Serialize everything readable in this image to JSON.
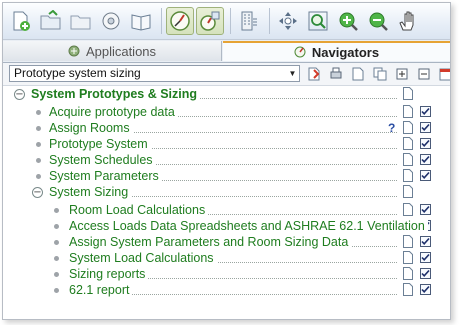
{
  "toolbar": {
    "buttons": [
      {
        "name": "new-icon"
      },
      {
        "name": "open-folder-icon"
      },
      {
        "name": "folder-icon"
      },
      {
        "name": "disc-icon"
      },
      {
        "name": "book-icon"
      },
      {
        "name": "compass-icon",
        "pressed": true
      },
      {
        "name": "compass-grid-icon",
        "pressed": true
      },
      {
        "name": "building-icon"
      },
      {
        "name": "pan-icon"
      },
      {
        "name": "zoom-extent-icon"
      },
      {
        "name": "zoom-in-icon"
      },
      {
        "name": "zoom-out-icon"
      },
      {
        "name": "hand-icon"
      }
    ]
  },
  "tabs": {
    "applications": "Applications",
    "navigators": "Navigators"
  },
  "navigator": {
    "selected": "Prototype system sizing"
  },
  "tree": {
    "root": "System Prototypes & Sizing",
    "items": [
      "Acquire prototype data",
      "Assign Rooms",
      "Prototype System",
      "System Schedules",
      "System Parameters"
    ],
    "group": "System Sizing",
    "subitems": [
      "Room Load Calculations",
      "Access Loads Data Spreadsheets and ASHRAE 62.1 Ventilation",
      "Assign System Parameters and Room Sizing Data",
      "System Load Calculations",
      "Sizing reports",
      "62.1 report"
    ],
    "help_mark": "?"
  },
  "colors": {
    "tree_text": "#1f7d1f",
    "accent_tab": "#e6a335"
  }
}
